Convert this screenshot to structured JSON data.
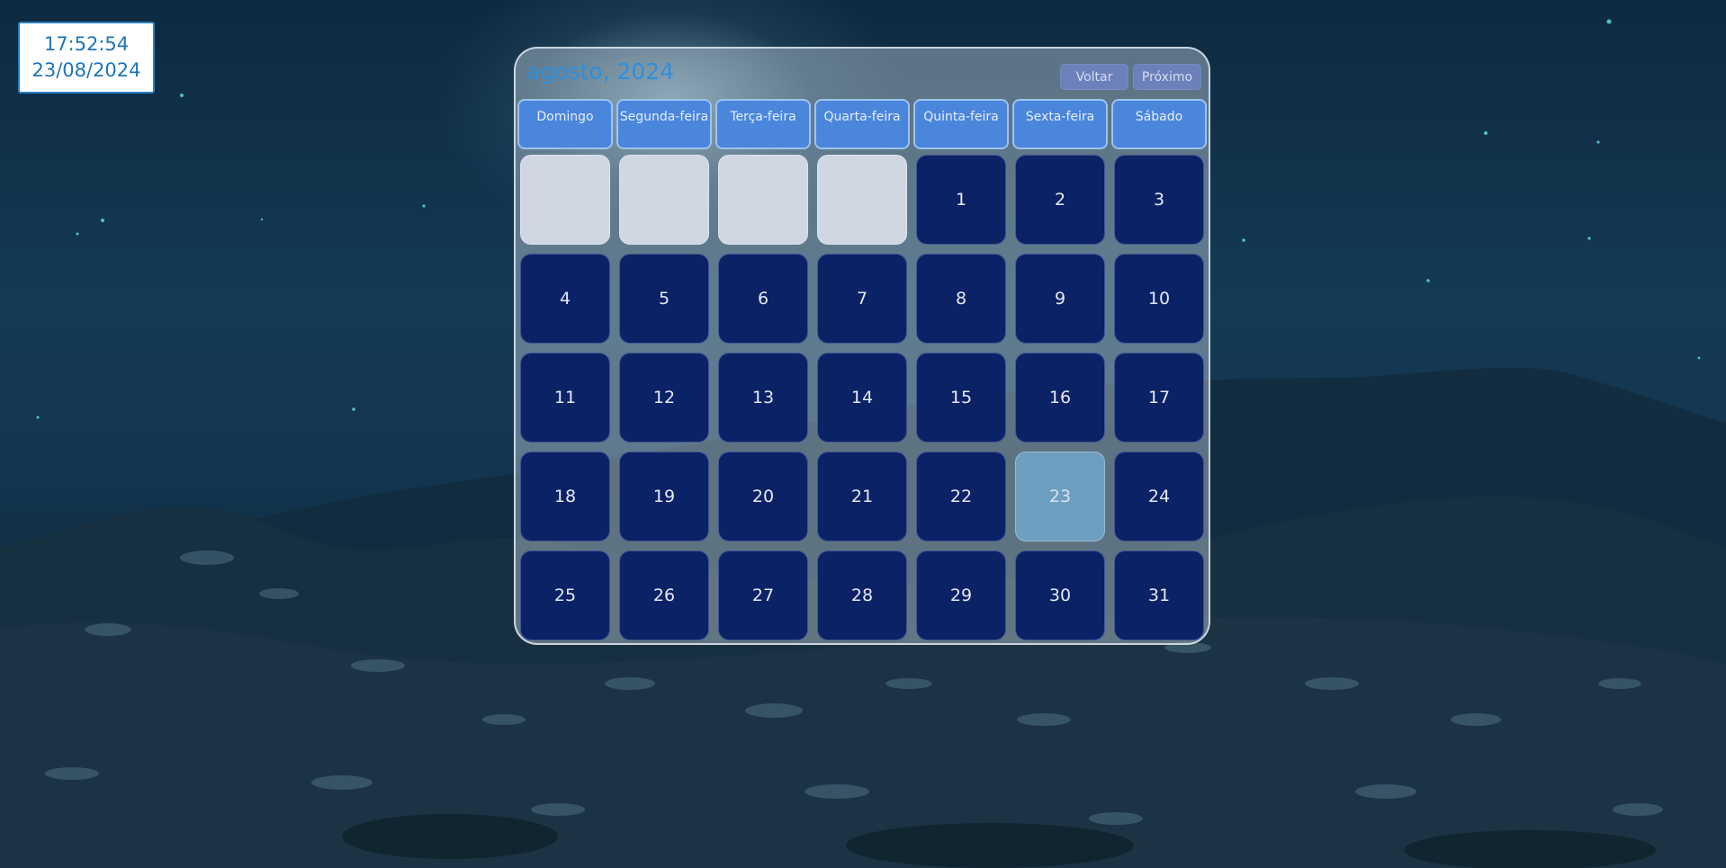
{
  "clock": {
    "time": "17:52:54",
    "date": "23/08/2024"
  },
  "calendar": {
    "title": "agosto, 2024",
    "buttons": {
      "back": "Voltar",
      "next": "Próximo"
    },
    "weekdays": [
      {
        "label": "Domingo"
      },
      {
        "label": "Segunda-feira"
      },
      {
        "label": "Terça-feira"
      },
      {
        "label": "Quarta-feira"
      },
      {
        "label": "Quinta-feira"
      },
      {
        "label": "Sexta-feira"
      },
      {
        "label": "Sábado"
      }
    ],
    "days": [
      {
        "n": "",
        "empty": true
      },
      {
        "n": "",
        "empty": true
      },
      {
        "n": "",
        "empty": true
      },
      {
        "n": "",
        "empty": true
      },
      {
        "n": "1"
      },
      {
        "n": "2"
      },
      {
        "n": "3"
      },
      {
        "n": "4"
      },
      {
        "n": "5"
      },
      {
        "n": "6"
      },
      {
        "n": "7"
      },
      {
        "n": "8"
      },
      {
        "n": "9"
      },
      {
        "n": "10"
      },
      {
        "n": "11"
      },
      {
        "n": "12"
      },
      {
        "n": "13"
      },
      {
        "n": "14"
      },
      {
        "n": "15"
      },
      {
        "n": "16"
      },
      {
        "n": "17"
      },
      {
        "n": "18"
      },
      {
        "n": "19"
      },
      {
        "n": "20"
      },
      {
        "n": "21"
      },
      {
        "n": "22"
      },
      {
        "n": "23",
        "today": true
      },
      {
        "n": "24"
      },
      {
        "n": "25"
      },
      {
        "n": "26"
      },
      {
        "n": "27"
      },
      {
        "n": "28"
      },
      {
        "n": "29"
      },
      {
        "n": "30"
      },
      {
        "n": "31"
      }
    ]
  },
  "colors": {
    "day_bg": "#0b2266",
    "today_bg": "#6e9ec0",
    "empty_bg": "#cfd7e3",
    "weekday_bg": "#4a86dc",
    "accent": "#2c8fe0"
  }
}
